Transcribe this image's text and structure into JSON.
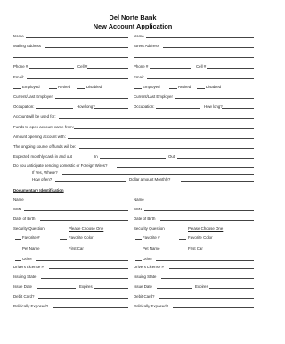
{
  "header": {
    "bank_name": "Del Norte Bank",
    "form_title": "New Account Application"
  },
  "form": {
    "name": "Name",
    "mailing_address": "Mailing Address",
    "street_address": "Street Address",
    "phone": "Phone #",
    "cell": "Cell #",
    "email": "Email:",
    "employed": "Employed",
    "retired": "Retired",
    "disabled": "Disabled",
    "current_last_employer": "Current/Last Employer",
    "occupation": "Occupation:",
    "how_long": "How long?",
    "account_used_for": "Account will be used for:",
    "funds_from": "Funds to open account came from:",
    "amount_opening": "Amount opening account with:",
    "ongoing_source": "The ongoing source of funds will be:",
    "monthly_cash": "Expected monthly cash in and out",
    "in_label": "In",
    "out_label": "Out",
    "wires_question": "Do you anticipate sending domestic or Foreign Wires?",
    "if_yes_where": "If Yes, Where?",
    "how_often": "How often?",
    "dollar_monthly": "Dollar amount Monthly?"
  },
  "identification": {
    "section_title": "Documentary Identification",
    "name": "Name",
    "ssn": "SSN",
    "dob": "Date of Birth",
    "security_question": "Security Question",
    "please_choose": "Please Choose One",
    "favorite_hash": "Favorite #",
    "favorite_color": "Favorite Color",
    "pet_name": "Pet Name",
    "first_car": "First Car",
    "other": "Other",
    "drivers_license": "Drivers License #",
    "issuing_state": "Issuing State",
    "issue_date": "Issue Date",
    "expires": "Expires",
    "debit_card": "Debit Card?",
    "politically_exposed": "Politically Exposed?"
  }
}
